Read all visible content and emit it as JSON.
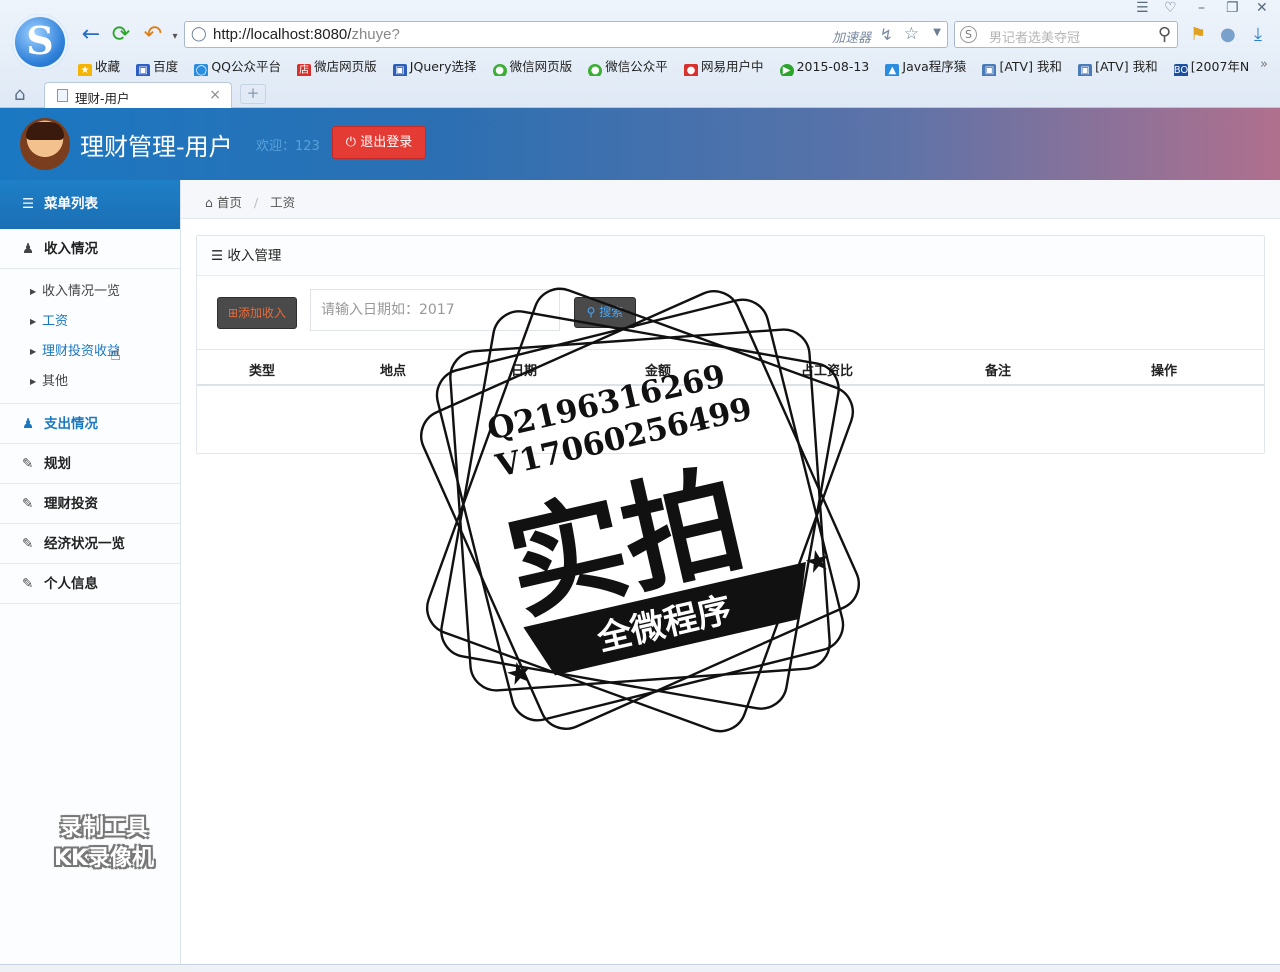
{
  "browser": {
    "address_url": "http://localhost:8080/",
    "address_path": "zhuye?",
    "accelerator_label": "加速器",
    "search_placeholder": "男记者选美夺冠",
    "bookmarks": [
      "收藏",
      "百度",
      "QQ公众平台",
      "微店网页版",
      "JQuery选择",
      "微信网页版",
      "微信公众平",
      "网易用户中",
      "2015-08-13",
      "Java程序猿",
      "[ATV] 我和",
      "[ATV] 我和",
      "[2007年N"
    ],
    "tab_title": "理财-用户"
  },
  "header": {
    "title": "理财管理-用户",
    "welcome": "欢迎：123",
    "logout_label": "退出登录"
  },
  "sidebar": {
    "heading": "菜单列表",
    "income_label": "收入情况",
    "income_sub": [
      "收入情况一览",
      "工资",
      "理财投资收益",
      "其他"
    ],
    "expense_label": "支出情况",
    "plan_label": "规划",
    "invest_label": "理财投资",
    "economy_label": "经济状况一览",
    "profile_label": "个人信息"
  },
  "breadcrumb": {
    "home": "首页",
    "current": "工资"
  },
  "panel": {
    "title": "收入管理",
    "add_label": "添加收入",
    "search_placeholder": "请输入日期如：2017",
    "search_label": "搜索",
    "columns": [
      "类型",
      "地点",
      "日期",
      "金额",
      "占工资比",
      "备注",
      "操作"
    ]
  },
  "watermark": {
    "qq": "Q2196316269",
    "wechat": "V17060256499",
    "big_text": "实拍",
    "ribbon": "全微程序",
    "recorder_line1": "录制工具",
    "recorder_line2": "KK录像机"
  },
  "colors": {
    "header_blue": "#1a78c2",
    "logout_red": "#e53b35",
    "active_blue": "#1b78c0"
  }
}
